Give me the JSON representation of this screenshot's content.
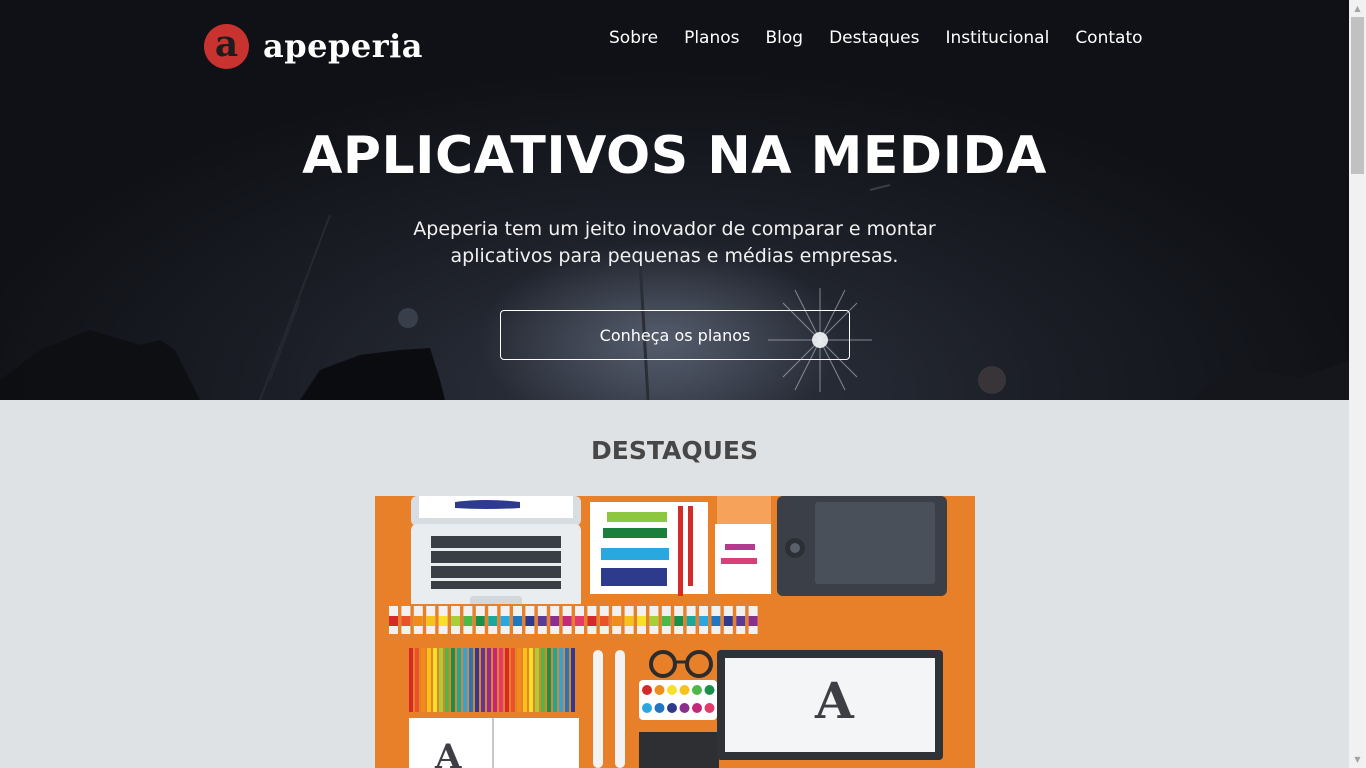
{
  "header": {
    "logo_letter": "a",
    "brand": "apeperia",
    "nav": [
      "Sobre",
      "Planos",
      "Blog",
      "Destaques",
      "Institucional",
      "Contato"
    ]
  },
  "hero": {
    "title": "APLICATIVOS NA MEDIDA",
    "subtitle_line1": "Apeperia tem um jeito inovador de comparar e montar",
    "subtitle_line2": "aplicativos para pequenas e médias empresas.",
    "cta": "Conheça os planos"
  },
  "destaques": {
    "title": "DESTAQUES",
    "image_icon": "designer-desk-illustration-icon"
  },
  "colors": {
    "brand_red": "#c8332f",
    "hero_dark": "#1b1e26",
    "section_bg": "#dfe2e5",
    "illustration_orange": "#e8802a"
  }
}
